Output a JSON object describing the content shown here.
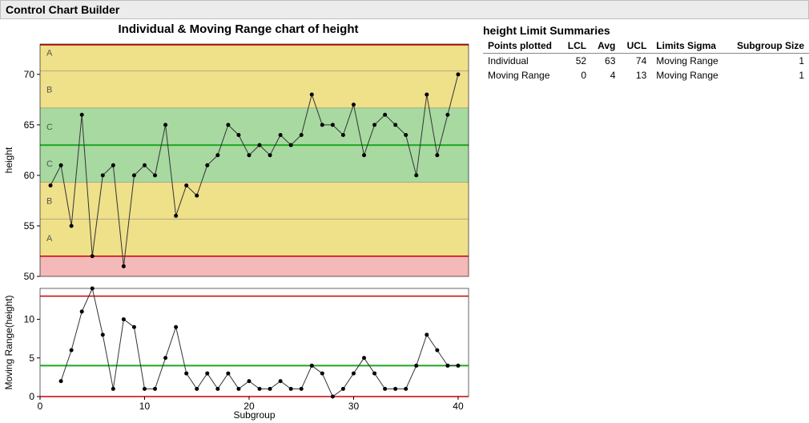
{
  "header": {
    "title": "Control Chart Builder"
  },
  "summary": {
    "title": "height Limit Summaries",
    "columns": [
      "Points plotted",
      "LCL",
      "Avg",
      "UCL",
      "Limits Sigma",
      "Subgroup Size"
    ],
    "rows": [
      {
        "name": "Individual",
        "lcl": 52,
        "avg": 63,
        "ucl": 74,
        "sigma": "Moving Range",
        "size": 1
      },
      {
        "name": "Moving Range",
        "lcl": 0,
        "avg": 4,
        "ucl": 13,
        "sigma": "Moving Range",
        "size": 1
      }
    ]
  },
  "chart_data": [
    {
      "type": "line",
      "title": "Individual & Moving Range chart of height",
      "ylabel": "height",
      "xlabel": "Subgroup",
      "ylim": [
        50,
        73
      ],
      "center": 63,
      "lcl": 52,
      "ucl": 74,
      "sigma": 3.67,
      "zones": [
        "A",
        "B",
        "C",
        "C",
        "B",
        "A"
      ],
      "x": [
        1,
        2,
        3,
        4,
        5,
        6,
        7,
        8,
        9,
        10,
        11,
        12,
        13,
        14,
        15,
        16,
        17,
        18,
        19,
        20,
        21,
        22,
        23,
        24,
        25,
        26,
        27,
        28,
        29,
        30,
        31,
        32,
        33,
        34,
        35,
        36,
        37,
        38,
        39,
        40
      ],
      "values": [
        59,
        61,
        55,
        66,
        52,
        60,
        61,
        51,
        60,
        61,
        60,
        65,
        56,
        59,
        58,
        61,
        62,
        65,
        64,
        62,
        63,
        62,
        64,
        63,
        64,
        68,
        65,
        65,
        64,
        67,
        62,
        65,
        66,
        65,
        64,
        60,
        68,
        62,
        66,
        70
      ]
    },
    {
      "type": "line",
      "ylabel": "Moving Range(height)",
      "xlabel": "Subgroup",
      "ylim": [
        0,
        14
      ],
      "center": 4,
      "lcl": 0,
      "ucl": 13,
      "x": [
        2,
        3,
        4,
        5,
        6,
        7,
        8,
        9,
        10,
        11,
        12,
        13,
        14,
        15,
        16,
        17,
        18,
        19,
        20,
        21,
        22,
        23,
        24,
        25,
        26,
        27,
        28,
        29,
        30,
        31,
        32,
        33,
        34,
        35,
        36,
        37,
        38,
        39,
        40
      ],
      "values": [
        2,
        6,
        11,
        14,
        8,
        1,
        10,
        9,
        1,
        1,
        5,
        9,
        3,
        1,
        3,
        1,
        3,
        1,
        2,
        1,
        1,
        2,
        1,
        1,
        4,
        3,
        0,
        1,
        3,
        5,
        3,
        1,
        1,
        1,
        4,
        8,
        6,
        4,
        4
      ]
    }
  ]
}
